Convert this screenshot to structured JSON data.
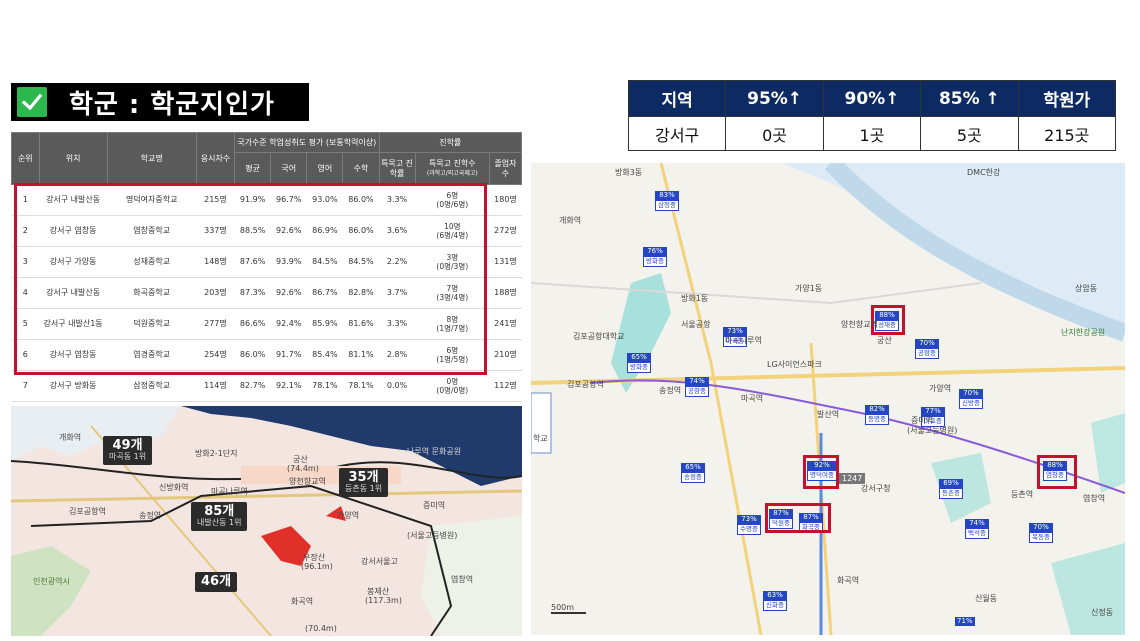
{
  "title": {
    "text": "학군 : 학군지인가",
    "icon": "check-icon",
    "accent": "#2db84d"
  },
  "summary": {
    "headers": [
      "지역",
      "95%↑",
      "90%↑",
      "85% ↑",
      "학원가"
    ],
    "row": [
      "강서구",
      "0곳",
      "1곳",
      "5곳",
      "215곳"
    ],
    "header_color": "#0e2a63"
  },
  "ranking": {
    "header_group_eval": "국가수준 학업성취도 평가 (보통학력이상)",
    "header_group_progress": "진학률",
    "headers": {
      "rank": "순위",
      "location": "위치",
      "school": "학교명",
      "exam_count": "응시자수",
      "avg": "평균",
      "korean": "국어",
      "english": "영어",
      "math": "수학",
      "special_rate": "특목고 진학률",
      "special_count": "특목고 진학수",
      "special_sub": "(과학고/외고국제고)",
      "graduates": "졸업자 수"
    },
    "rows": [
      {
        "rank": "1",
        "location": "강서구 내발산동",
        "school": "명덕여자중학교",
        "exam": "215명",
        "avg": "91.9%",
        "kor": "96.7%",
        "eng": "93.0%",
        "math": "86.0%",
        "rate": "3.3%",
        "count": "6명",
        "detail": "(0명/6명)",
        "grad": "180명"
      },
      {
        "rank": "2",
        "location": "강서구 염창동",
        "school": "염창중학교",
        "exam": "337명",
        "avg": "88.5%",
        "kor": "92.6%",
        "eng": "86.9%",
        "math": "86.0%",
        "rate": "3.6%",
        "count": "10명",
        "detail": "(6명/4명)",
        "grad": "272명"
      },
      {
        "rank": "3",
        "location": "강서구 가양동",
        "school": "성재중학교",
        "exam": "148명",
        "avg": "87.6%",
        "kor": "93.9%",
        "eng": "84.5%",
        "math": "84.5%",
        "rate": "2.2%",
        "count": "3명",
        "detail": "(0명/3명)",
        "grad": "131명"
      },
      {
        "rank": "4",
        "location": "강서구 내발산동",
        "school": "화곡중학교",
        "exam": "203명",
        "avg": "87.3%",
        "kor": "92.6%",
        "eng": "86.7%",
        "math": "82.8%",
        "rate": "3.7%",
        "count": "7명",
        "detail": "(3명/4명)",
        "grad": "188명"
      },
      {
        "rank": "5",
        "location": "강서구 내발산1동",
        "school": "덕원중학교",
        "exam": "277명",
        "avg": "86.6%",
        "kor": "92.4%",
        "eng": "85.9%",
        "math": "81.6%",
        "rate": "3.3%",
        "count": "8명",
        "detail": "(1명/7명)",
        "grad": "241명"
      },
      {
        "rank": "6",
        "location": "강서구 염창동",
        "school": "염경중학교",
        "exam": "254명",
        "avg": "86.0%",
        "kor": "91.7%",
        "eng": "85.4%",
        "math": "81.1%",
        "rate": "2.8%",
        "count": "6명",
        "detail": "(1명/5명)",
        "grad": "210명"
      },
      {
        "rank": "7",
        "location": "강서구 방화동",
        "school": "삼정중학교",
        "exam": "114명",
        "avg": "82.7%",
        "kor": "92.1%",
        "eng": "78.1%",
        "math": "78.1%",
        "rate": "0.0%",
        "count": "0명",
        "detail": "(0명/0명)",
        "grad": "112명"
      }
    ]
  },
  "map_left": {
    "badges": [
      {
        "count": "49개",
        "rank": "마곡동 1위"
      },
      {
        "count": "35개",
        "rank": "등촌동 1위"
      },
      {
        "count": "85개",
        "rank": "내발산동 1위"
      },
      {
        "count": "46개",
        "rank": ""
      }
    ],
    "labels": {
      "gaehwa": "개화역",
      "magoknaru": "마곡나루역",
      "yangcheon": "양천향교역",
      "gimpo_airport": "김포공항역",
      "gayang": "가양역",
      "jeungmi": "증미역",
      "jeungmi_sub": "(서울고등병원)",
      "ujangsan": "우장산",
      "ujangsan_h": "(96.1m)",
      "seoul_hs": "강서서울고",
      "bongjesan": "봉제산",
      "bongjesan_h": "(117.3m)",
      "hwagok": "화곡역",
      "songjeong": "송정역",
      "gungsan": "궁산",
      "gungsan_h": "(74.4m)",
      "hangang": "나루역 문화공원",
      "bangwha": "방화2-1단지",
      "sinbang": "신방화역",
      "yeomchang": "염창역",
      "hwagok2": "(70.4m)",
      "incheon": "인천광역시"
    }
  },
  "map_right": {
    "pins": [
      {
        "pct": "83%",
        "name": "삼정중"
      },
      {
        "pct": "76%",
        "name": "방화중"
      },
      {
        "pct": "88%",
        "name": "성재중"
      },
      {
        "pct": "73%",
        "name": "마곡중"
      },
      {
        "pct": "65%",
        "name": "방화중"
      },
      {
        "pct": "70%",
        "name": "공항중"
      },
      {
        "pct": "74%",
        "name": "공항중"
      },
      {
        "pct": "82%",
        "name": "등명중"
      },
      {
        "pct": "77%",
        "name": "마포중"
      },
      {
        "pct": "70%",
        "name": "신방중"
      },
      {
        "pct": "65%",
        "name": "송정중"
      },
      {
        "pct": "92%",
        "name": "명덕여중"
      },
      {
        "pct": "88%",
        "name": "염창중"
      },
      {
        "pct": "69%",
        "name": "등촌중"
      },
      {
        "pct": "87%",
        "name": "덕원중"
      },
      {
        "pct": "73%",
        "name": "수명중"
      },
      {
        "pct": "87%",
        "name": "화곡중"
      },
      {
        "pct": "74%",
        "name": "백석중"
      },
      {
        "pct": "70%",
        "name": "목동중"
      },
      {
        "pct": "63%",
        "name": "신화중"
      },
      {
        "pct": "71%",
        "name": ""
      }
    ],
    "labels": {
      "banghwa": "방화3동",
      "gaehwa": "개화역",
      "gimpo": "김포공항역",
      "songjeong": "송정역",
      "magok": "마곡역",
      "balsan": "발산역",
      "yangcheon": "양천향교역",
      "gayang": "가양역",
      "jeungmi": "증미역",
      "jeungmi_sub": "(서울고등병원)",
      "hwagok": "화곡역",
      "gangseo": "강서구청",
      "dmc": "DMC한강",
      "sangam": "상암동",
      "nanji": "난지한강공원",
      "banghwa1": "방화1동",
      "gayang1": "가양1동",
      "yeomchang": "염창역",
      "deungchon": "등촌역",
      "sinwon": "신월동",
      "magoknaru": "마곡나루역",
      "seoul_hs": "서울공항",
      "sinjeong": "신정동",
      "gungsan": "궁산",
      "lg": "LG사이언스파크",
      "scale": "500m",
      "gimpo_school": "김포공항대학교",
      "hakgyo": "학교",
      "num": "1247"
    }
  }
}
